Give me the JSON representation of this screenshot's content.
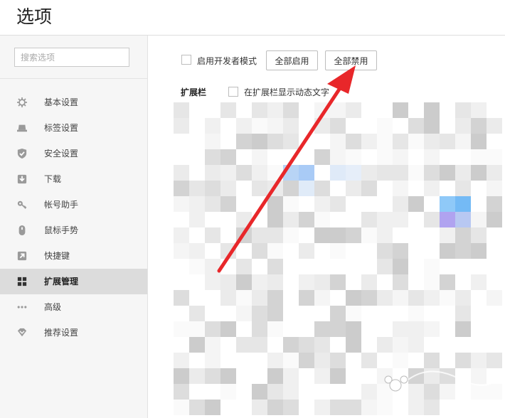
{
  "header": {
    "title": "选项"
  },
  "sidebar": {
    "search_placeholder": "搜索选项",
    "items": [
      {
        "label": "基本设置",
        "icon": "gear-icon"
      },
      {
        "label": "标签设置",
        "icon": "tab-icon"
      },
      {
        "label": "安全设置",
        "icon": "shield-check-icon"
      },
      {
        "label": "下载",
        "icon": "download-icon"
      },
      {
        "label": "帐号助手",
        "icon": "key-icon"
      },
      {
        "label": "鼠标手势",
        "icon": "mouse-icon"
      },
      {
        "label": "快捷键",
        "icon": "shortcut-arrow-icon"
      },
      {
        "label": "扩展管理",
        "icon": "grid-icon",
        "active": true
      },
      {
        "label": "高级",
        "icon": "more-dots-icon"
      },
      {
        "label": "推荐设置",
        "icon": "heart-diamond-icon"
      }
    ]
  },
  "main": {
    "developer_mode_label": "启用开发者模式",
    "enable_all_label": "全部启用",
    "disable_all_label": "全部禁用",
    "extension_bar_label": "扩展栏",
    "show_dynamic_text_label": "在扩展栏显示动态文字"
  },
  "colors": {
    "accent_arrow": "#e8272a",
    "sidebar_bg": "#f6f6f6",
    "active_item_bg": "#dcdcdc"
  }
}
